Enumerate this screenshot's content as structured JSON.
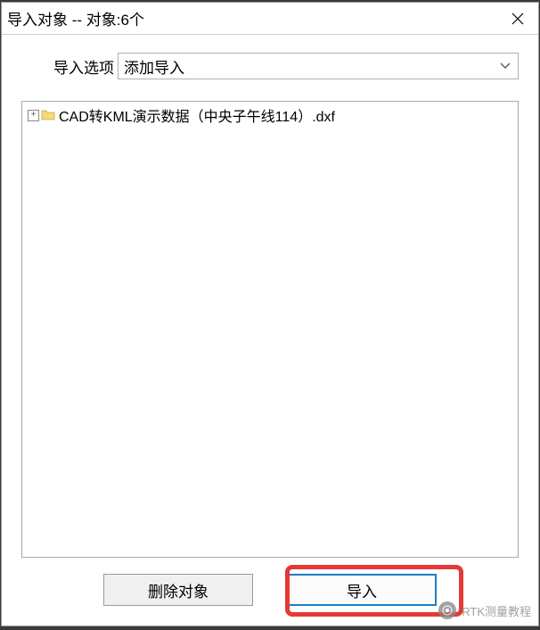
{
  "window": {
    "title": "导入对象 -- 对象:6个"
  },
  "options": {
    "label": "导入选项",
    "selected": "添加导入"
  },
  "tree": {
    "items": [
      {
        "label": "CAD转KML演示数据（中央子午线114）.dxf"
      }
    ]
  },
  "buttons": {
    "delete": "删除对象",
    "import": "导入"
  },
  "watermark": {
    "text": "RTK测量教程"
  }
}
